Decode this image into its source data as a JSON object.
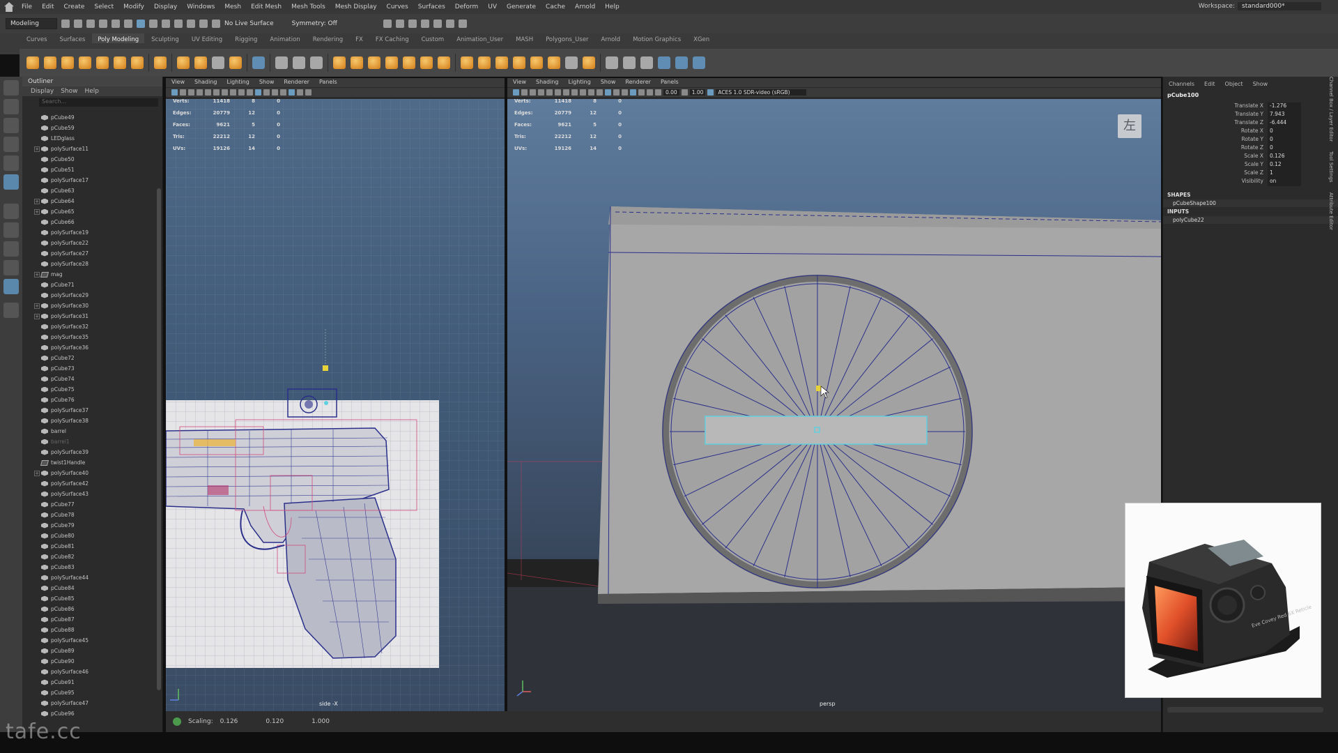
{
  "menubar": {
    "items": [
      "File",
      "Edit",
      "Create",
      "Select",
      "Modify",
      "Display",
      "Windows",
      "Mesh",
      "Edit Mesh",
      "Mesh Tools",
      "Mesh Display",
      "Curves",
      "Surfaces",
      "Deform",
      "UV",
      "Generate",
      "Cache",
      "Arnold",
      "Help"
    ],
    "workspace_label": "Workspace:",
    "workspace_value": "standard000*"
  },
  "statusline": {
    "mode": "Modeling",
    "live_surface": "No Live Surface",
    "symmetry": "Symmetry: Off"
  },
  "shelf_tabs": [
    "Curves",
    "Surfaces",
    "Poly Modeling",
    "Sculpting",
    "UV Editing",
    "Rigging",
    "Animation",
    "Rendering",
    "FX",
    "FX Caching",
    "Custom",
    "Animation_User",
    "MASH",
    "Polygons_User",
    "Arnold",
    "Motion Graphics",
    "XGen"
  ],
  "shelf_active": "Poly Modeling",
  "outliner": {
    "title": "Outliner",
    "menu": [
      "Display",
      "Show",
      "Help"
    ],
    "search_placeholder": "Search...",
    "items": [
      {
        "name": "pCube49",
        "exp": false
      },
      {
        "name": "pCube59",
        "exp": false
      },
      {
        "name": "LEDglass",
        "exp": false
      },
      {
        "name": "polySurface11",
        "exp": true
      },
      {
        "name": "pCube50",
        "exp": false
      },
      {
        "name": "pCube51",
        "exp": false
      },
      {
        "name": "polySurface17",
        "exp": false
      },
      {
        "name": "pCube63",
        "exp": false
      },
      {
        "name": "pCube64",
        "exp": true
      },
      {
        "name": "pCube65",
        "exp": true
      },
      {
        "name": "pCube66",
        "exp": false
      },
      {
        "name": "polySurface19",
        "exp": false
      },
      {
        "name": "polySurface22",
        "exp": false
      },
      {
        "name": "polySurface27",
        "exp": false
      },
      {
        "name": "polySurface28",
        "exp": false
      },
      {
        "name": "mag",
        "exp": true,
        "grp": true
      },
      {
        "name": "pCube71",
        "exp": false
      },
      {
        "name": "polySurface29",
        "exp": false
      },
      {
        "name": "polySurface30",
        "exp": true
      },
      {
        "name": "polySurface31",
        "exp": true
      },
      {
        "name": "polySurface32",
        "exp": false
      },
      {
        "name": "polySurface35",
        "exp": false
      },
      {
        "name": "polySurface36",
        "exp": false
      },
      {
        "name": "pCube72",
        "exp": false
      },
      {
        "name": "pCube73",
        "exp": false
      },
      {
        "name": "pCube74",
        "exp": false
      },
      {
        "name": "pCube75",
        "exp": false
      },
      {
        "name": "pCube76",
        "exp": false
      },
      {
        "name": "polySurface37",
        "exp": false
      },
      {
        "name": "polySurface38",
        "exp": false
      },
      {
        "name": "barrel",
        "exp": false
      },
      {
        "name": "barrel1",
        "exp": false,
        "dim": true
      },
      {
        "name": "polySurface39",
        "exp": false
      },
      {
        "name": "twist1Handle",
        "exp": false,
        "grp": true
      },
      {
        "name": "polySurface40",
        "exp": true
      },
      {
        "name": "polySurface42",
        "exp": false
      },
      {
        "name": "polySurface43",
        "exp": false
      },
      {
        "name": "pCube77",
        "exp": false
      },
      {
        "name": "pCube78",
        "exp": false
      },
      {
        "name": "pCube79",
        "exp": false
      },
      {
        "name": "pCube80",
        "exp": false
      },
      {
        "name": "pCube81",
        "exp": false
      },
      {
        "name": "pCube82",
        "exp": false
      },
      {
        "name": "pCube83",
        "exp": false
      },
      {
        "name": "polySurface44",
        "exp": false
      },
      {
        "name": "pCube84",
        "exp": false
      },
      {
        "name": "pCube85",
        "exp": false
      },
      {
        "name": "pCube86",
        "exp": false
      },
      {
        "name": "pCube87",
        "exp": false
      },
      {
        "name": "pCube88",
        "exp": false
      },
      {
        "name": "polySurface45",
        "exp": false
      },
      {
        "name": "pCube89",
        "exp": false
      },
      {
        "name": "pCube90",
        "exp": false
      },
      {
        "name": "polySurface46",
        "exp": false
      },
      {
        "name": "pCube91",
        "exp": false
      },
      {
        "name": "pCube95",
        "exp": false
      },
      {
        "name": "polySurface47",
        "exp": false
      },
      {
        "name": "pCube96",
        "exp": false
      }
    ]
  },
  "viewport_menu": [
    "View",
    "Shading",
    "Lighting",
    "Show",
    "Renderer",
    "Panels"
  ],
  "hud": {
    "rows": [
      {
        "label": "Verts:",
        "a": "11418",
        "b": "8",
        "c": "0"
      },
      {
        "label": "Edges:",
        "a": "20779",
        "b": "12",
        "c": "0"
      },
      {
        "label": "Faces:",
        "a": "9621",
        "b": "5",
        "c": "0"
      },
      {
        "label": "Tris:",
        "a": "22212",
        "b": "12",
        "c": "0"
      },
      {
        "label": "UVs:",
        "a": "19126",
        "b": "14",
        "c": "0"
      }
    ]
  },
  "side_view": {
    "camera": "side -X"
  },
  "persp_view": {
    "camera": "persp",
    "exposure": "0.00",
    "gamma": "1.00",
    "colorspace": "ACES 1.0 SDR-video (sRGB)",
    "view_cube_label": "左"
  },
  "channel_box": {
    "menu": [
      "Channels",
      "Edit",
      "Object",
      "Show"
    ],
    "object": "pCube100",
    "channels": [
      {
        "label": "Translate X",
        "value": "-1.276"
      },
      {
        "label": "Translate Y",
        "value": "7.943"
      },
      {
        "label": "Translate Z",
        "value": "-6.444"
      },
      {
        "label": "Rotate X",
        "value": "0"
      },
      {
        "label": "Rotate Y",
        "value": "0"
      },
      {
        "label": "Rotate Z",
        "value": "0"
      },
      {
        "label": "Scale X",
        "value": "0.126"
      },
      {
        "label": "Scale Y",
        "value": "0.12"
      },
      {
        "label": "Scale Z",
        "value": "1"
      },
      {
        "label": "Visibility",
        "value": "on"
      }
    ],
    "shapes_label": "SHAPES",
    "shape": "pCubeShape100",
    "inputs_label": "INPUTS",
    "input": "polyCube22",
    "side_tabs": [
      "Channel Box / Layer Editor",
      "Tool Settings",
      "Attribute Editor"
    ]
  },
  "helpline": {
    "label": "Scaling:",
    "x": "0.126",
    "y": "0.120",
    "z": "1.000"
  },
  "watermark": "tafe.cc",
  "reference_photo": {
    "engraving": "Eve Covey Red 6X Reticle"
  },
  "colors": {
    "selection_yellow": "#e8d23a",
    "wire_blue": "#1d2a8f",
    "wire_pink": "#d24a7a",
    "highlight_cyan": "#5fd0e0"
  }
}
